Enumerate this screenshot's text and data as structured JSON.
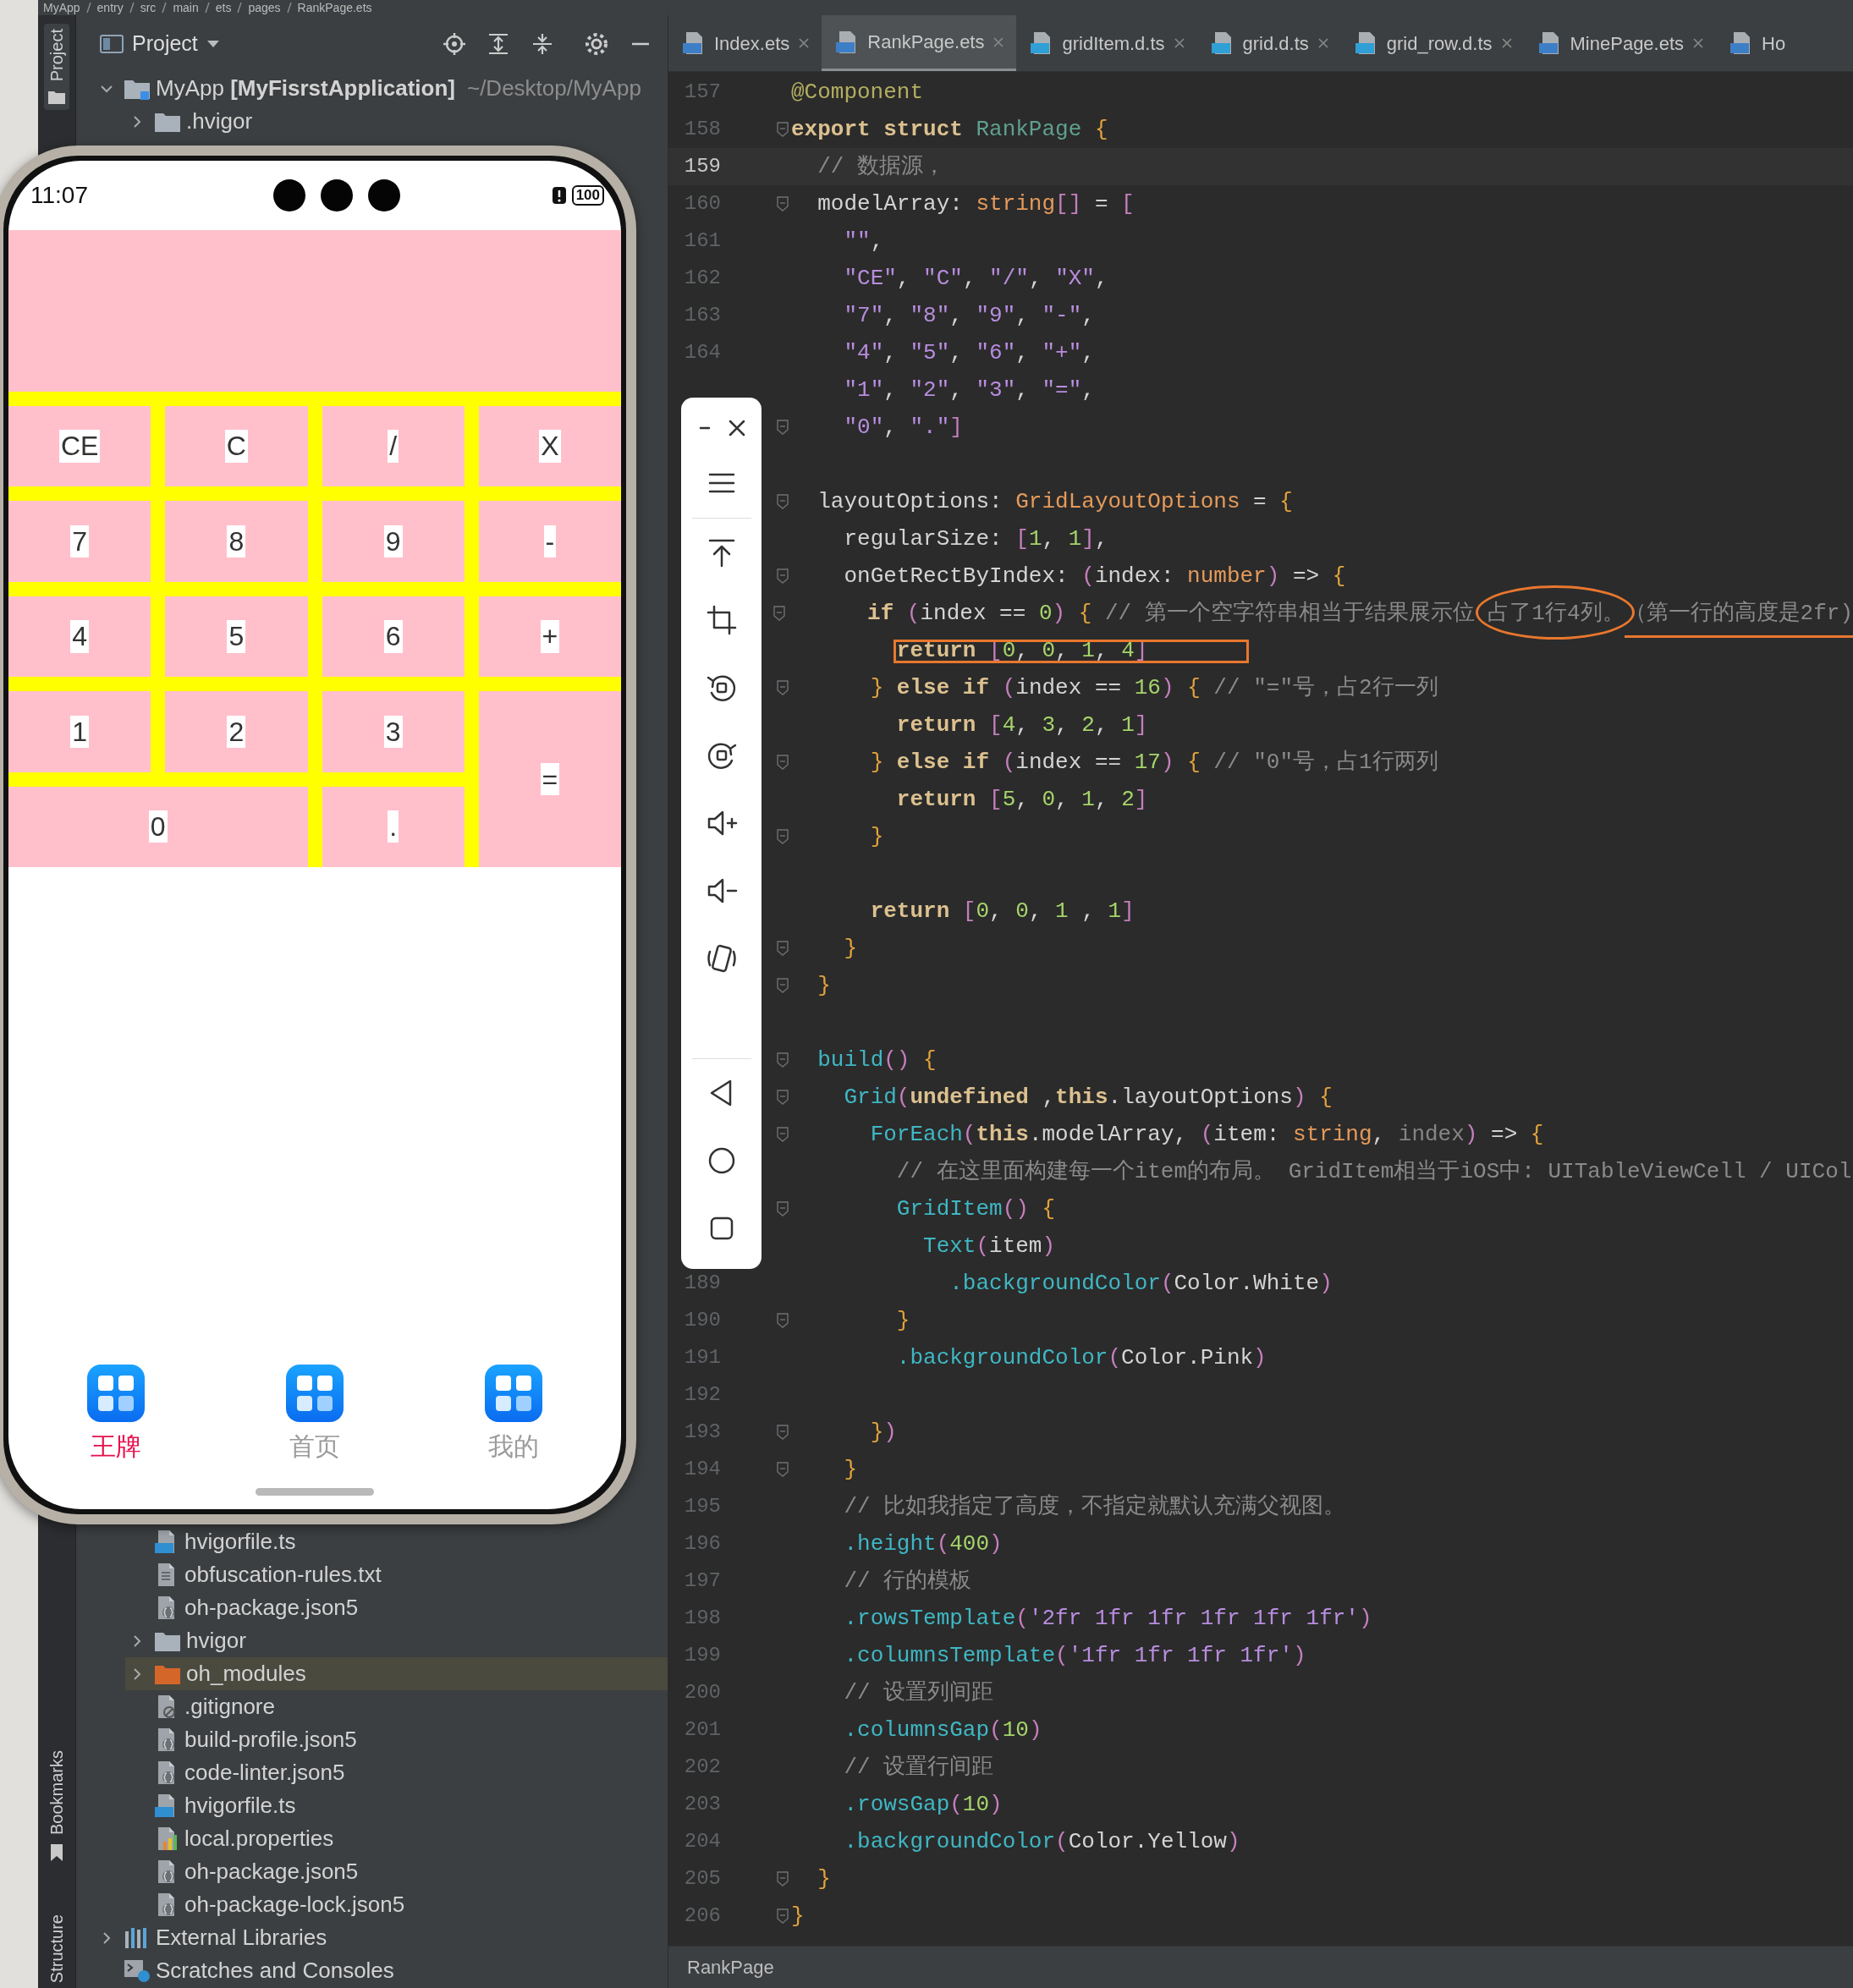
{
  "breadcrumb": [
    "MyApp",
    "entry",
    "src",
    "main",
    "ets",
    "pages",
    "RankPage.ets"
  ],
  "tool_strip": {
    "top": [
      {
        "kind": "project",
        "label": "Project",
        "selected": true
      }
    ],
    "bottom": [
      {
        "kind": "bookmarks",
        "label": "Bookmarks",
        "selected": false
      },
      {
        "kind": "structure",
        "label": "Structure",
        "selected": false
      }
    ]
  },
  "project_panel": {
    "title": "Project",
    "tree": [
      {
        "kind": "module",
        "label": "MyApp **[MyFisrstApplication]**",
        "path": "~/Desktop/MyApp",
        "expanded": true,
        "selected": false,
        "children": [
          {
            "kind": "folder",
            "label": ".hvigor",
            "expanded": false,
            "selected": false
          },
          {
            "kind": "obscured",
            "children": [
              {
                "kind": "ts",
                "label": "hvigorfile.ts",
                "selected": false
              },
              {
                "kind": "txt",
                "label": "obfuscation-rules.txt",
                "selected": false
              },
              {
                "kind": "json5",
                "label": "oh-package.json5",
                "selected": false
              }
            ]
          },
          {
            "kind": "folder",
            "label": "hvigor",
            "expanded": false,
            "selected": false
          },
          {
            "kind": "folder-excluded",
            "label": "oh_modules",
            "expanded": false,
            "selected": true
          },
          {
            "kind": "gitignore",
            "label": ".gitignore",
            "selected": false
          },
          {
            "kind": "json5",
            "label": "build-profile.json5",
            "selected": false
          },
          {
            "kind": "json5",
            "label": "code-linter.json5",
            "selected": false
          },
          {
            "kind": "ts",
            "label": "hvigorfile.ts",
            "selected": false
          },
          {
            "kind": "properties",
            "label": "local.properties",
            "selected": false
          },
          {
            "kind": "json5",
            "label": "oh-package.json5",
            "selected": false
          },
          {
            "kind": "json5",
            "label": "oh-package-lock.json5",
            "selected": false
          }
        ]
      },
      {
        "kind": "libraries",
        "label": "External Libraries",
        "expanded": false,
        "selected": false
      },
      {
        "kind": "scratches",
        "label": "Scratches and Consoles",
        "selected": false
      }
    ]
  },
  "editor": {
    "tabs": [
      {
        "kind": "ets",
        "label": "Index.ets",
        "selected": false,
        "closable": true
      },
      {
        "kind": "ets",
        "label": "RankPage.ets",
        "selected": true,
        "closable": true
      },
      {
        "kind": "ts",
        "label": "gridItem.d.ts",
        "selected": false,
        "closable": true
      },
      {
        "kind": "ts",
        "label": "grid.d.ts",
        "selected": false,
        "closable": true
      },
      {
        "kind": "ts",
        "label": "grid_row.d.ts",
        "selected": false,
        "closable": true
      },
      {
        "kind": "ets",
        "label": "MinePage.ets",
        "selected": false,
        "closable": true
      },
      {
        "kind": "ets",
        "label": "Ho",
        "selected": false,
        "closable": false
      }
    ],
    "code_lines": [
      {
        "kind": "code",
        "number": "157",
        "fold": false,
        "current": false,
        "tokens": [
          {
            "kind": "ann",
            "text": "@Component"
          }
        ]
      },
      {
        "kind": "code",
        "number": "158",
        "fold": true,
        "current": false,
        "tokens": [
          {
            "kind": "kw",
            "text": "export struct "
          },
          {
            "kind": "type",
            "text": "RankPage "
          },
          {
            "kind": "brace",
            "text": "{"
          }
        ]
      },
      {
        "kind": "code",
        "number": "159",
        "fold": false,
        "current": true,
        "tokens": [
          {
            "kind": "cmt",
            "text": "  // 数据源，"
          }
        ]
      },
      {
        "kind": "code",
        "number": "160",
        "fold": true,
        "current": false,
        "tokens": [
          {
            "kind": "p",
            "text": "  modelArray: "
          },
          {
            "kind": "type2",
            "text": "string"
          },
          {
            "kind": "brk",
            "text": "[]"
          },
          {
            "kind": "p",
            "text": " = "
          },
          {
            "kind": "brk",
            "text": "["
          }
        ]
      },
      {
        "kind": "code",
        "number": "161",
        "fold": false,
        "current": false,
        "tokens": [
          {
            "kind": "str",
            "text": "    \"\""
          },
          {
            "kind": "p",
            "text": ","
          }
        ]
      },
      {
        "kind": "code",
        "number": "162",
        "fold": false,
        "current": false,
        "tokens": [
          {
            "kind": "str",
            "text": "    \"CE\""
          },
          {
            "kind": "p",
            "text": ", "
          },
          {
            "kind": "str",
            "text": "\"C\""
          },
          {
            "kind": "p",
            "text": ", "
          },
          {
            "kind": "str",
            "text": "\"/\""
          },
          {
            "kind": "p",
            "text": ", "
          },
          {
            "kind": "str",
            "text": "\"X\""
          },
          {
            "kind": "p",
            "text": ","
          }
        ]
      },
      {
        "kind": "code",
        "number": "163",
        "fold": false,
        "current": false,
        "tokens": [
          {
            "kind": "str",
            "text": "    \"7\""
          },
          {
            "kind": "p",
            "text": ", "
          },
          {
            "kind": "str",
            "text": "\"8\""
          },
          {
            "kind": "p",
            "text": ", "
          },
          {
            "kind": "str",
            "text": "\"9\""
          },
          {
            "kind": "p",
            "text": ", "
          },
          {
            "kind": "str",
            "text": "\"-\""
          },
          {
            "kind": "p",
            "text": ","
          }
        ]
      },
      {
        "kind": "code",
        "number": "164",
        "fold": false,
        "current": false,
        "tokens": [
          {
            "kind": "str",
            "text": "    \"4\""
          },
          {
            "kind": "p",
            "text": ", "
          },
          {
            "kind": "str",
            "text": "\"5\""
          },
          {
            "kind": "p",
            "text": ", "
          },
          {
            "kind": "str",
            "text": "\"6\""
          },
          {
            "kind": "p",
            "text": ", "
          },
          {
            "kind": "str",
            "text": "\"+\""
          },
          {
            "kind": "p",
            "text": ","
          }
        ]
      },
      {
        "kind": "code",
        "fold": false,
        "current": false,
        "tokens": [
          {
            "kind": "str",
            "text": "    \"1\""
          },
          {
            "kind": "p",
            "text": ", "
          },
          {
            "kind": "str",
            "text": "\"2\""
          },
          {
            "kind": "p",
            "text": ", "
          },
          {
            "kind": "str",
            "text": "\"3\""
          },
          {
            "kind": "p",
            "text": ", "
          },
          {
            "kind": "str",
            "text": "\"=\""
          },
          {
            "kind": "p",
            "text": ","
          }
        ]
      },
      {
        "kind": "code",
        "fold": true,
        "current": false,
        "tokens": [
          {
            "kind": "str",
            "text": "    \"0\""
          },
          {
            "kind": "p",
            "text": ", "
          },
          {
            "kind": "str",
            "text": "\".\""
          },
          {
            "kind": "brk",
            "text": "]"
          }
        ]
      },
      {
        "kind": "blank"
      },
      {
        "kind": "code",
        "fold": true,
        "current": false,
        "tokens": [
          {
            "kind": "p",
            "text": "  layoutOptions: "
          },
          {
            "kind": "type2",
            "text": "GridLayoutOptions"
          },
          {
            "kind": "p",
            "text": " = "
          },
          {
            "kind": "brace",
            "text": "{"
          }
        ]
      },
      {
        "kind": "code",
        "fold": false,
        "current": false,
        "tokens": [
          {
            "kind": "p",
            "text": "    regularSize: "
          },
          {
            "kind": "brk",
            "text": "["
          },
          {
            "kind": "num",
            "text": "1"
          },
          {
            "kind": "p",
            "text": ", "
          },
          {
            "kind": "num",
            "text": "1"
          },
          {
            "kind": "brk",
            "text": "]"
          },
          {
            "kind": "p",
            "text": ","
          }
        ]
      },
      {
        "kind": "code",
        "fold": true,
        "current": false,
        "tokens": [
          {
            "kind": "p",
            "text": "    onGetRectByIndex: "
          },
          {
            "kind": "brk",
            "text": "("
          },
          {
            "kind": "p",
            "text": "index: "
          },
          {
            "kind": "type2",
            "text": "number"
          },
          {
            "kind": "brk",
            "text": ")"
          },
          {
            "kind": "p",
            "text": " => "
          },
          {
            "kind": "brace",
            "text": "{"
          }
        ]
      },
      {
        "kind": "code",
        "fold": true,
        "current": false,
        "tokens": [
          {
            "kind": "kw",
            "text": "      if "
          },
          {
            "kind": "brk",
            "text": "("
          },
          {
            "kind": "p",
            "text": "index == "
          },
          {
            "kind": "num",
            "text": "0"
          },
          {
            "kind": "brk",
            "text": ") "
          },
          {
            "kind": "brace",
            "text": "{"
          },
          {
            "kind": "cmt",
            "text": " // 第一个空字符串相当于结果展示位 "
          },
          {
            "kind": "cmt",
            "text": "占了1行4列。",
            "circled": true
          },
          {
            "kind": "cmt",
            "text": "（第一行的高度是2fr)",
            "underlined": true
          }
        ]
      },
      {
        "kind": "code",
        "fold": false,
        "current": false,
        "boxed": true,
        "tokens": [
          {
            "kind": "kw",
            "text": "        return "
          },
          {
            "kind": "brk",
            "text": "["
          },
          {
            "kind": "num",
            "text": "0"
          },
          {
            "kind": "p",
            "text": ", "
          },
          {
            "kind": "num",
            "text": "0"
          },
          {
            "kind": "p",
            "text": ", "
          },
          {
            "kind": "num",
            "text": "1"
          },
          {
            "kind": "p",
            "text": ", "
          },
          {
            "kind": "num",
            "text": "4"
          },
          {
            "kind": "brk",
            "text": "]"
          }
        ]
      },
      {
        "kind": "code",
        "fold": true,
        "current": false,
        "tokens": [
          {
            "kind": "brace",
            "text": "      } "
          },
          {
            "kind": "kw",
            "text": "else if "
          },
          {
            "kind": "brk",
            "text": "("
          },
          {
            "kind": "p",
            "text": "index == "
          },
          {
            "kind": "num",
            "text": "16"
          },
          {
            "kind": "brk",
            "text": ") "
          },
          {
            "kind": "brace",
            "text": "{"
          },
          {
            "kind": "cmt",
            "text": " // \"=\"号，占2行一列"
          }
        ]
      },
      {
        "kind": "code",
        "fold": false,
        "current": false,
        "tokens": [
          {
            "kind": "kw",
            "text": "        return "
          },
          {
            "kind": "brk",
            "text": "["
          },
          {
            "kind": "num",
            "text": "4"
          },
          {
            "kind": "p",
            "text": ", "
          },
          {
            "kind": "num",
            "text": "3"
          },
          {
            "kind": "p",
            "text": ", "
          },
          {
            "kind": "num",
            "text": "2"
          },
          {
            "kind": "p",
            "text": ", "
          },
          {
            "kind": "num",
            "text": "1"
          },
          {
            "kind": "brk",
            "text": "]"
          }
        ]
      },
      {
        "kind": "code",
        "fold": true,
        "current": false,
        "tokens": [
          {
            "kind": "brace",
            "text": "      } "
          },
          {
            "kind": "kw",
            "text": "else if "
          },
          {
            "kind": "brk",
            "text": "("
          },
          {
            "kind": "p",
            "text": "index == "
          },
          {
            "kind": "num",
            "text": "17"
          },
          {
            "kind": "brk",
            "text": ") "
          },
          {
            "kind": "brace",
            "text": "{"
          },
          {
            "kind": "cmt",
            "text": " // \"0\"号，占1行两列"
          }
        ]
      },
      {
        "kind": "code",
        "fold": false,
        "current": false,
        "tokens": [
          {
            "kind": "kw",
            "text": "        return "
          },
          {
            "kind": "brk",
            "text": "["
          },
          {
            "kind": "num",
            "text": "5"
          },
          {
            "kind": "p",
            "text": ", "
          },
          {
            "kind": "num",
            "text": "0"
          },
          {
            "kind": "p",
            "text": ", "
          },
          {
            "kind": "num",
            "text": "1"
          },
          {
            "kind": "p",
            "text": ", "
          },
          {
            "kind": "num",
            "text": "2"
          },
          {
            "kind": "brk",
            "text": "]"
          }
        ]
      },
      {
        "kind": "code",
        "fold": true,
        "current": false,
        "tokens": [
          {
            "kind": "brace",
            "text": "      }"
          }
        ]
      },
      {
        "kind": "blank"
      },
      {
        "kind": "code",
        "fold": false,
        "current": false,
        "tokens": [
          {
            "kind": "kw",
            "text": "      return "
          },
          {
            "kind": "brk",
            "text": "["
          },
          {
            "kind": "num",
            "text": "0"
          },
          {
            "kind": "p",
            "text": ", "
          },
          {
            "kind": "num",
            "text": "0"
          },
          {
            "kind": "p",
            "text": ", "
          },
          {
            "kind": "num",
            "text": "1"
          },
          {
            "kind": "p",
            "text": " , "
          },
          {
            "kind": "num",
            "text": "1"
          },
          {
            "kind": "brk",
            "text": "]"
          }
        ]
      },
      {
        "kind": "code",
        "fold": true,
        "current": false,
        "tokens": [
          {
            "kind": "brace",
            "text": "    }"
          }
        ]
      },
      {
        "kind": "code",
        "fold": true,
        "current": false,
        "tokens": [
          {
            "kind": "brace",
            "text": "  }"
          }
        ]
      },
      {
        "kind": "blank"
      },
      {
        "kind": "code",
        "fold": true,
        "current": false,
        "tokens": [
          {
            "kind": "fn",
            "text": "  build"
          },
          {
            "kind": "brk",
            "text": "() "
          },
          {
            "kind": "brace",
            "text": "{"
          }
        ]
      },
      {
        "kind": "code",
        "fold": true,
        "current": false,
        "tokens": [
          {
            "kind": "fn",
            "text": "    Grid"
          },
          {
            "kind": "brk",
            "text": "("
          },
          {
            "kind": "kw",
            "text": "undefined"
          },
          {
            "kind": "p",
            "text": " ,"
          },
          {
            "kind": "kw",
            "text": "this"
          },
          {
            "kind": "p",
            "text": ".layoutOptions"
          },
          {
            "kind": "brk",
            "text": ") "
          },
          {
            "kind": "brace",
            "text": "{"
          }
        ]
      },
      {
        "kind": "code",
        "fold": true,
        "current": false,
        "tokens": [
          {
            "kind": "fn",
            "text": "      ForEach"
          },
          {
            "kind": "brk",
            "text": "("
          },
          {
            "kind": "kw",
            "text": "this"
          },
          {
            "kind": "p",
            "text": ".modelArray, "
          },
          {
            "kind": "brk",
            "text": "("
          },
          {
            "kind": "p",
            "text": "item: "
          },
          {
            "kind": "type2",
            "text": "string"
          },
          {
            "kind": "p",
            "text": ", "
          },
          {
            "kind": "dim",
            "text": "index"
          },
          {
            "kind": "brk",
            "text": ")"
          },
          {
            "kind": "p",
            "text": " => "
          },
          {
            "kind": "brace",
            "text": "{"
          }
        ]
      },
      {
        "kind": "code",
        "fold": false,
        "current": false,
        "tokens": [
          {
            "kind": "cmt",
            "text": "        // 在这里面构建每一个item的布局。 GridItem相当于iOS中: UITableViewCell / UICol"
          }
        ]
      },
      {
        "kind": "code",
        "fold": true,
        "current": false,
        "tokens": [
          {
            "kind": "fn",
            "text": "        GridItem"
          },
          {
            "kind": "brk",
            "text": "() "
          },
          {
            "kind": "brace",
            "text": "{"
          }
        ]
      },
      {
        "kind": "code",
        "fold": false,
        "current": false,
        "tokens": [
          {
            "kind": "fn",
            "text": "          Text"
          },
          {
            "kind": "brk",
            "text": "("
          },
          {
            "kind": "p",
            "text": "item"
          },
          {
            "kind": "brk",
            "text": ")"
          }
        ]
      },
      {
        "kind": "code",
        "number": "189",
        "fold": false,
        "current": false,
        "tokens": [
          {
            "kind": "fn",
            "text": "            .backgroundColor"
          },
          {
            "kind": "brk",
            "text": "("
          },
          {
            "kind": "p",
            "text": "Color.White"
          },
          {
            "kind": "brk",
            "text": ")"
          }
        ]
      },
      {
        "kind": "code",
        "number": "190",
        "fold": true,
        "current": false,
        "tokens": [
          {
            "kind": "brace",
            "text": "        }"
          }
        ]
      },
      {
        "kind": "code",
        "number": "191",
        "fold": false,
        "current": false,
        "tokens": [
          {
            "kind": "fn",
            "text": "        .backgroundColor"
          },
          {
            "kind": "brk",
            "text": "("
          },
          {
            "kind": "p",
            "text": "Color.Pink"
          },
          {
            "kind": "brk",
            "text": ")"
          }
        ]
      },
      {
        "kind": "blank",
        "number": "192"
      },
      {
        "kind": "code",
        "number": "193",
        "fold": true,
        "current": false,
        "tokens": [
          {
            "kind": "brace",
            "text": "      }"
          },
          {
            "kind": "brk",
            "text": ")"
          }
        ]
      },
      {
        "kind": "code",
        "number": "194",
        "fold": true,
        "current": false,
        "tokens": [
          {
            "kind": "brace",
            "text": "    }"
          }
        ]
      },
      {
        "kind": "code",
        "number": "195",
        "fold": false,
        "current": false,
        "tokens": [
          {
            "kind": "cmt",
            "text": "    // 比如我指定了高度，不指定就默认充满父视图。"
          }
        ]
      },
      {
        "kind": "code",
        "number": "196",
        "fold": false,
        "current": false,
        "tokens": [
          {
            "kind": "fn",
            "text": "    .height"
          },
          {
            "kind": "brk",
            "text": "("
          },
          {
            "kind": "num",
            "text": "400"
          },
          {
            "kind": "brk",
            "text": ")"
          }
        ]
      },
      {
        "kind": "code",
        "number": "197",
        "fold": false,
        "current": false,
        "tokens": [
          {
            "kind": "cmt",
            "text": "    // 行的模板"
          }
        ]
      },
      {
        "kind": "code",
        "number": "198",
        "fold": false,
        "current": false,
        "tokens": [
          {
            "kind": "fn",
            "text": "    .rowsTemplate"
          },
          {
            "kind": "brk",
            "text": "("
          },
          {
            "kind": "str",
            "text": "'2fr 1fr 1fr 1fr 1fr 1fr'"
          },
          {
            "kind": "brk",
            "text": ")"
          }
        ]
      },
      {
        "kind": "code",
        "number": "199",
        "fold": false,
        "current": false,
        "tokens": [
          {
            "kind": "fn",
            "text": "    .columnsTemplate"
          },
          {
            "kind": "brk",
            "text": "("
          },
          {
            "kind": "str",
            "text": "'1fr 1fr 1fr 1fr'"
          },
          {
            "kind": "brk",
            "text": ")"
          }
        ]
      },
      {
        "kind": "code",
        "number": "200",
        "fold": false,
        "current": false,
        "tokens": [
          {
            "kind": "cmt",
            "text": "    // 设置列间距"
          }
        ]
      },
      {
        "kind": "code",
        "number": "201",
        "fold": false,
        "current": false,
        "tokens": [
          {
            "kind": "fn",
            "text": "    .columnsGap"
          },
          {
            "kind": "brk",
            "text": "("
          },
          {
            "kind": "num",
            "text": "10"
          },
          {
            "kind": "brk",
            "text": ")"
          }
        ]
      },
      {
        "kind": "code",
        "number": "202",
        "fold": false,
        "current": false,
        "tokens": [
          {
            "kind": "cmt",
            "text": "    // 设置行间距"
          }
        ]
      },
      {
        "kind": "code",
        "number": "203",
        "fold": false,
        "current": false,
        "tokens": [
          {
            "kind": "fn",
            "text": "    .rowsGap"
          },
          {
            "kind": "brk",
            "text": "("
          },
          {
            "kind": "num",
            "text": "10"
          },
          {
            "kind": "brk",
            "text": ")"
          }
        ]
      },
      {
        "kind": "code",
        "number": "204",
        "fold": false,
        "current": false,
        "tokens": [
          {
            "kind": "fn",
            "text": "    .backgroundColor"
          },
          {
            "kind": "brk",
            "text": "("
          },
          {
            "kind": "p",
            "text": "Color.Yellow"
          },
          {
            "kind": "brk",
            "text": ")"
          }
        ]
      },
      {
        "kind": "code",
        "number": "205",
        "fold": true,
        "current": false,
        "tokens": [
          {
            "kind": "brace",
            "text": "  }"
          }
        ]
      },
      {
        "kind": "code",
        "number": "206",
        "fold": true,
        "current": false,
        "tokens": [
          {
            "kind": "brace",
            "text": "}"
          }
        ]
      }
    ],
    "status_bar": {
      "breadcrumb": "RankPage"
    }
  },
  "phone": {
    "time": "11:07",
    "battery": "100",
    "calculator": [
      {
        "kind": "display"
      },
      {
        "kind": "key",
        "label": "CE"
      },
      {
        "kind": "key",
        "label": "C"
      },
      {
        "kind": "key",
        "label": "/"
      },
      {
        "kind": "key",
        "label": "X"
      },
      {
        "kind": "key",
        "label": "7"
      },
      {
        "kind": "key",
        "label": "8"
      },
      {
        "kind": "key",
        "label": "9"
      },
      {
        "kind": "key",
        "label": "-"
      },
      {
        "kind": "key",
        "label": "4"
      },
      {
        "kind": "key",
        "label": "5"
      },
      {
        "kind": "key",
        "label": "6"
      },
      {
        "kind": "key",
        "label": "+"
      },
      {
        "kind": "key",
        "label": "1"
      },
      {
        "kind": "key",
        "label": "2"
      },
      {
        "kind": "key",
        "label": "3"
      },
      {
        "kind": "tall",
        "label": "="
      },
      {
        "kind": "wide",
        "label": "0"
      },
      {
        "kind": "key",
        "label": "."
      }
    ],
    "tabbar": [
      {
        "label": "王牌",
        "selected": true
      },
      {
        "label": "首页",
        "selected": false
      },
      {
        "label": "我的",
        "selected": false
      }
    ]
  }
}
